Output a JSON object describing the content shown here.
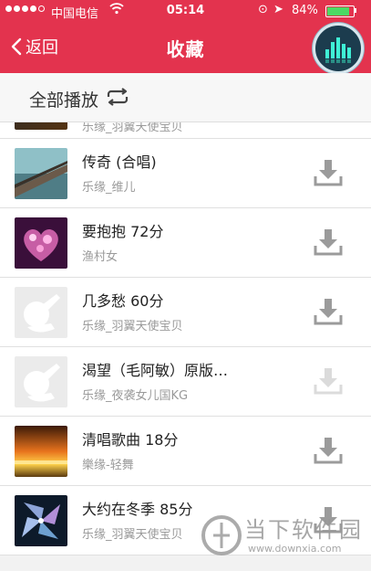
{
  "status_bar": {
    "carrier": "中国电信",
    "time": "05:14",
    "battery": "84%",
    "battery_level": 0.84
  },
  "nav": {
    "back_label": "返回",
    "title": "收藏"
  },
  "play_all": {
    "label": "全部播放"
  },
  "partial_row": {
    "artist": "乐缘_羽翼天使宝贝"
  },
  "songs": [
    {
      "title": "传奇 (合唱)",
      "artist": "乐缘_维儿",
      "thumb": "pier-photo",
      "download_enabled": true
    },
    {
      "title": "要抱抱 72分",
      "artist": "渔村女",
      "thumb": "heart-bokeh",
      "download_enabled": true
    },
    {
      "title": "几多愁 60分",
      "artist": "乐缘_羽翼天使宝贝",
      "thumb": "placeholder",
      "download_enabled": true
    },
    {
      "title": "渴望（毛阿敏）原版…",
      "artist": "乐缘_夜袭女儿国KG",
      "thumb": "placeholder",
      "download_enabled": false
    },
    {
      "title": "清唱歌曲 18分",
      "artist": "樂缘-轻舞",
      "thumb": "sunset",
      "download_enabled": true
    },
    {
      "title": "大约在冬季 85分",
      "artist": "乐缘_羽翼天使宝贝",
      "thumb": "pinwheel",
      "download_enabled": true
    }
  ],
  "watermark": {
    "text": "当下软件园",
    "url": "www.downxia.com"
  },
  "colors": {
    "accent": "#e3334e",
    "download_icon": "#9b9b9b"
  }
}
